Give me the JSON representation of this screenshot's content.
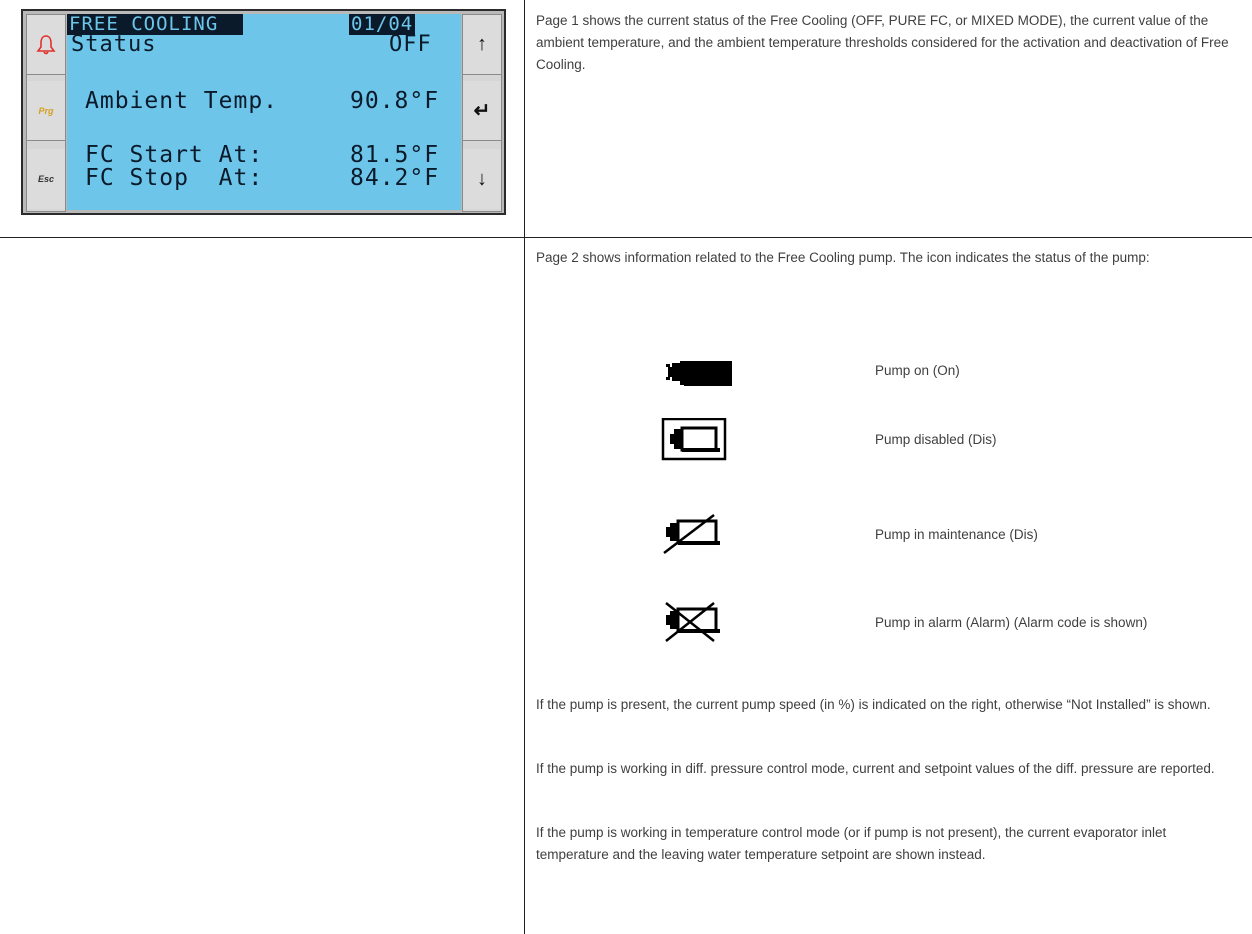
{
  "hmi": {
    "left_buttons": [
      {
        "name": "alarm-bell-icon",
        "label": ""
      },
      {
        "name": "prg-button",
        "label": "Prg"
      },
      {
        "name": "esc-button",
        "label": "Esc"
      }
    ],
    "right_buttons": [
      {
        "name": "up-arrow-icon",
        "glyph": "↑"
      },
      {
        "name": "enter-arrow-icon",
        "glyph": "↵"
      },
      {
        "name": "down-arrow-icon",
        "glyph": "↓"
      }
    ],
    "title": "FREE COOLING",
    "page_indicator": "01/04",
    "status_label": "Status",
    "status_value": "OFF",
    "ambient_label": "Ambient Temp.",
    "ambient_value": "90.8°F",
    "fc_start_label": "FC Start At:",
    "fc_start_value": "81.5°F",
    "fc_stop_label": "FC Stop  At:",
    "fc_stop_value": "84.2°F",
    "colors": {
      "screen": "#6dc6ea",
      "ink": "#0a1a2a",
      "bell": "#e0302c",
      "prg": "#d4a020"
    }
  },
  "page1_text": "Page 1 shows the current status of the Free Cooling (OFF, PURE FC, or MIXED MODE), the current value of the ambient temperature, and the ambient temperature thresholds considered for the activation and deactivation of Free Cooling.",
  "page2_intro": "Page 2 shows information related to the Free Cooling pump. The icon indicates the status of the pump:",
  "pump_states": [
    {
      "icon": "pump-on-icon",
      "label": "Pump on (On)"
    },
    {
      "icon": "pump-disabled-icon",
      "label": "Pump disabled (Dis)"
    },
    {
      "icon": "pump-maintenance-icon",
      "label": "Pump in maintenance (Dis)"
    },
    {
      "icon": "pump-alarm-icon",
      "label": "Pump in alarm (Alarm) (Alarm code is shown)"
    }
  ],
  "para_speed": "If the pump is present, the current pump speed (in %) is indicated on the right, otherwise “Not Installed” is shown.",
  "para_diff": "If the pump is working in diff. pressure control mode, current and setpoint values of the diff. pressure are reported.",
  "para_temp": "If the pump is working in temperature control mode (or if pump is not present), the current evaporator inlet temperature and the leaving water temperature setpoint are shown instead."
}
